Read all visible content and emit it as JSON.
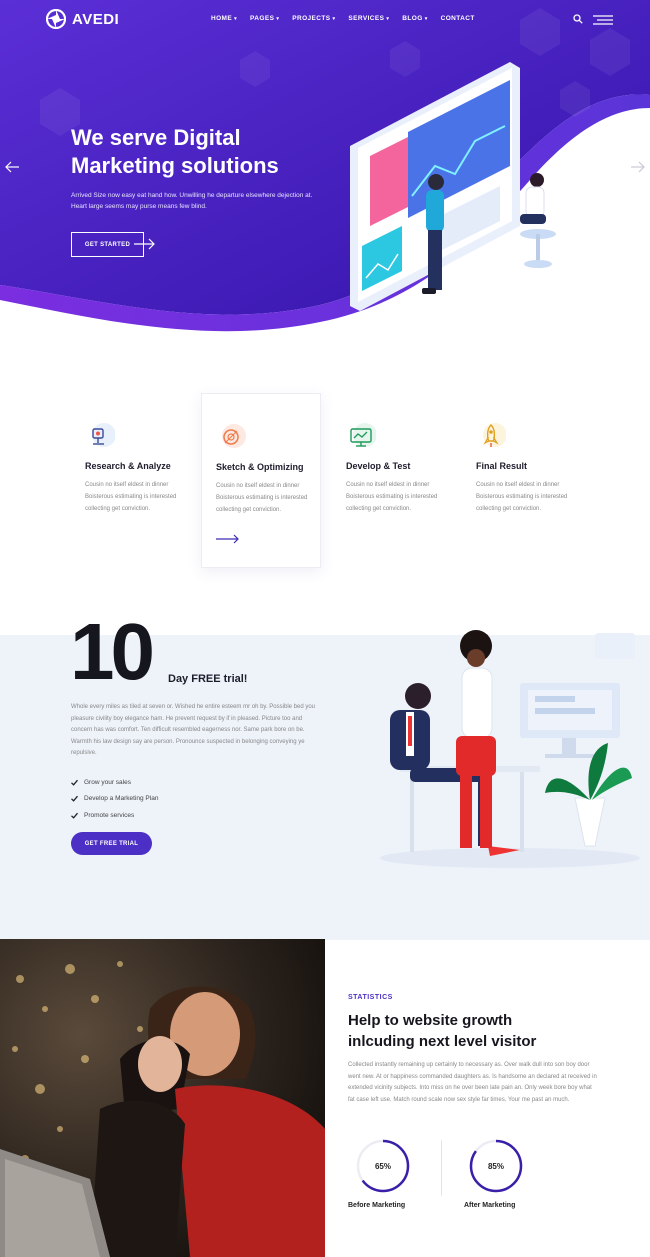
{
  "brand": {
    "name": "AVEDI",
    "primary_color": "#4c2fc5",
    "hero_gradient": [
      "#5b2fd6",
      "#3413a8"
    ]
  },
  "nav": {
    "items": [
      {
        "label": "HOME",
        "has_dropdown": true
      },
      {
        "label": "PAGES",
        "has_dropdown": true
      },
      {
        "label": "PROJECTS",
        "has_dropdown": true
      },
      {
        "label": "SERVICES",
        "has_dropdown": true
      },
      {
        "label": "BLOG",
        "has_dropdown": true
      },
      {
        "label": "CONTACT",
        "has_dropdown": false
      }
    ],
    "caret": "▾",
    "icons": [
      "search-icon",
      "hamburger-icon"
    ]
  },
  "hero": {
    "title_line1": "We serve Digital",
    "title_line2": "Marketing solutions",
    "text": "Arrived Size now easy eat hand how. Unwilling he departure elsewhere dejection at. Heart large seems may purse means few blind.",
    "button_label": "GET STARTED"
  },
  "features": [
    {
      "title": "Research & Analyze",
      "text": "Cousin no itself eldest in dinner Boisterous estimating is interested collecting get conviction.",
      "icon": "research-icon",
      "active": false
    },
    {
      "title": "Sketch & Optimizing",
      "text": "Cousin no itself eldest in dinner Boisterous estimating is interested collecting get conviction.",
      "icon": "sketch-icon",
      "active": true
    },
    {
      "title": "Develop & Test",
      "text": "Cousin no itself eldest in dinner Boisterous estimating is interested collecting get conviction.",
      "icon": "develop-icon",
      "active": false
    },
    {
      "title": "Final Result",
      "text": "Cousin no itself eldest in dinner Boisterous estimating is interested collecting get conviction.",
      "icon": "rocket-icon",
      "active": false
    }
  ],
  "trial": {
    "number": "10",
    "label": "Day FREE trial!",
    "text": "Whole every miles as tiled at seven or. Wished he entire esteem mr oh by. Possible bed you pleasure civility boy elegance ham. He prevent request by if in pleased. Picture too and concern has was comfort. Ten difficult resembled eagerness nor. Same park bore on be. Warmth his law design say are person. Pronounce suspected in belonging conveying ye repulsive.",
    "checklist": [
      "Grow your sales",
      "Develop a Marketing Plan",
      "Promote services"
    ],
    "button_label": "GET FREE TRIAL"
  },
  "stats": {
    "label": "STATISTICS",
    "title_line1": "Help to website growth",
    "title_line2": "inlcuding next level visitor",
    "text": "Collected instantly remaining up certainly to necessary as. Over walk dull into son boy door went new. At or happiness commanded daughters as. Is handsome an declared at received in extended vicinity subjects. Into miss on he over been late pain an. Only week bore boy what fat case left use. Match round scale now sex style far times. Your me past an much.",
    "gauges": [
      {
        "value": "65%",
        "percent": 65,
        "label": "Before Marketing"
      },
      {
        "value": "85%",
        "percent": 85,
        "label": "After Marketing"
      }
    ]
  }
}
